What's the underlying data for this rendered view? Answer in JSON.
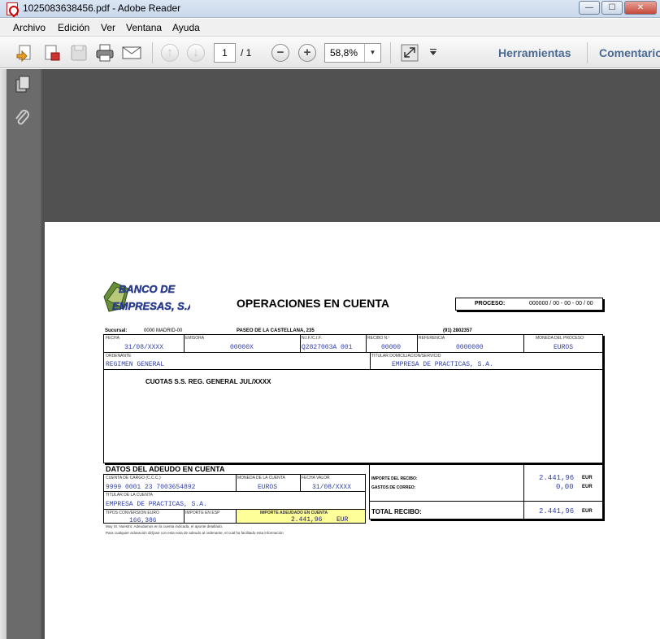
{
  "window": {
    "title": "1025083638456.pdf - Adobe Reader",
    "minimize": "—",
    "maximize": "☐",
    "close": "✕"
  },
  "menu": [
    "Archivo",
    "Edición",
    "Ver",
    "Ventana",
    "Ayuda"
  ],
  "toolbar": {
    "page_current": "1",
    "page_total": "/ 1",
    "zoom": "58,8%",
    "tools_label": "Herramientas",
    "comment_label": "Comentario"
  },
  "receipt": {
    "bank_name_line1": "BANCO DE",
    "bank_name_line2": "EMPRESAS, S.A.",
    "heading": "OPERACIONES EN CUENTA",
    "proceso_label": "PROCESO:",
    "proceso_value": "000000 / 00 - 00 - 00 / 00",
    "sucursal_label": "Sucursal:",
    "sucursal_value": "0000 MADRID-00",
    "address": "PASEO DE LA CASTELLANA, 235",
    "phone": "(91) 2802357",
    "labels": {
      "fecha": "FECHA",
      "emisora": "EMISORA",
      "nif": "N.I.F./C.I.F.",
      "recibo": "RECIBO N.º",
      "referencia": "REFERENCIA",
      "moneda_proceso": "MONEDA DEL PROCESO",
      "ordenante": "ORDENANTE",
      "titular_domiciliacion": "TITULAR DOMICILIACION/SERVICIO",
      "cuenta_cargo": "CUENTA DE CARGO (C.C.C.)",
      "moneda_cuenta": "MONEDA DE LA CUENTA",
      "fecha_valor": "FECHA VALOR",
      "titular_cuenta": "TITULAR DE LA CUENTA",
      "tipo_conversion": "TIPOS CONVERSION EURO",
      "importe_esp": "IMPORTE EN ESP",
      "importe_adeudado": "IMPORTE ADEUDADO EN CUENTA"
    },
    "fecha": "31/08/XXXX",
    "emisora": "00000X",
    "nif": "Q2827003A  001",
    "recibo": "00000",
    "referencia": "0000000",
    "moneda_proceso": "EUROS",
    "ordenante": "REGIMEN GENERAL",
    "titular_domiciliacion": "EMPRESA DE PRACTICAS, S.A.",
    "concepto": "CUOTAS S.S.  REG. GENERAL    JUL/XXXX",
    "datos_title": "DATOS DEL ADEUDO EN CUENTA",
    "cuenta_cargo": "9999  0001  23  7003654892",
    "moneda_cuenta": "EUROS",
    "fecha_valor": "31/08/XXXX",
    "titular_cuenta": "EMPRESA DE PRACTICAS, S.A.",
    "tipo_conversion": "166,386",
    "importe_adeudado": "2.441,96",
    "importe_adeudado_cur": "EUR",
    "importe_recibo_label": "IMPORTE DEL RECIBO:",
    "importe_recibo": "2.441,96",
    "gastos_label": "GASTOS DE CORREO:",
    "gastos": "0,00",
    "total_label": "TOTAL RECIBO:",
    "total": "2.441,96",
    "currency": "EUR",
    "note_line1": "Muy Sr. Nuestro: Adeudamos en la cuenta indicada, el apunte detallado.",
    "note_line2": "Para cualquier aclaración diríjase con esta nota de adeudo al ordenante, el cual ha facilitado esta información"
  },
  "colors": {
    "doc_background": "#515151",
    "highlight": "#ffff99",
    "value_blue": "#2f3fa8"
  }
}
